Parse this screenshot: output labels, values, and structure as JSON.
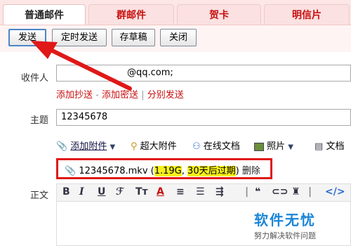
{
  "tabs": [
    {
      "label": "普通邮件"
    },
    {
      "label": "群邮件"
    },
    {
      "label": "贺卡"
    },
    {
      "label": "明信片"
    }
  ],
  "toolbar": {
    "send": "发送",
    "scheduled_send": "定时发送",
    "save_draft": "存草稿",
    "close": "关闭"
  },
  "recipient": {
    "label": "收件人",
    "value": "@qq.com;"
  },
  "recipient_links": {
    "add_cc": "添加抄送",
    "dash": "-",
    "add_bcc": "添加密送",
    "pipe": "|",
    "separate_send": "分别发送"
  },
  "subject": {
    "label": "主题",
    "value": "12345678"
  },
  "attach_bar": {
    "add_attachment": "添加附件",
    "large_attachment": "超大附件",
    "online_doc": "在线文档",
    "photo": "照片",
    "doc": "文档"
  },
  "attachment": {
    "filename": "12345678.mkv",
    "open_paren": "(",
    "size": "1.19G",
    "comma": ",",
    "expiry": "30天后过期",
    "close_paren": ")",
    "delete": "删除"
  },
  "body": {
    "label": "正文"
  },
  "watermark": {
    "title": "软件无忧",
    "subtitle": "努力解决软件问题"
  },
  "colors": {
    "accent_red": "#c81010",
    "highlight_yellow": "#f6ef1a",
    "annotation_red": "#e01818"
  }
}
